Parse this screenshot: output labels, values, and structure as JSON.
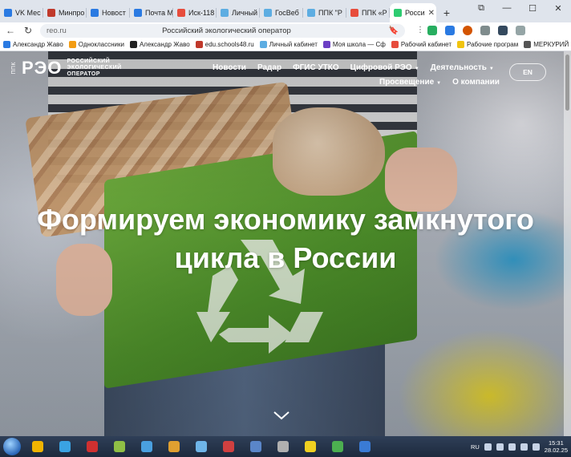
{
  "browser": {
    "tabs": [
      {
        "label": "VK Мес",
        "color": "#2a7ae2"
      },
      {
        "label": "Минпро",
        "color": "#c0392b"
      },
      {
        "label": "Новост",
        "color": "#2a7ae2"
      },
      {
        "label": "Почта М",
        "color": "#2a7ae2"
      },
      {
        "label": "Иск-118",
        "color": "#e74c3c"
      },
      {
        "label": "Личный",
        "color": "#5dade2"
      },
      {
        "label": "ГосВеб",
        "color": "#5dade2"
      },
      {
        "label": "ППК \"Р",
        "color": "#5dade2"
      },
      {
        "label": "ППК «Р",
        "color": "#e74c3c"
      },
      {
        "label": "Росси",
        "color": "#2ecc71",
        "active": true
      }
    ],
    "address_host": "reo.ru",
    "address_title": "Российский экологический оператор",
    "window_controls": [
      "⧉",
      "—",
      "☐",
      "✕"
    ]
  },
  "bookmarks": [
    {
      "label": "Александр Жаво",
      "color": "#2a7ae2"
    },
    {
      "label": "Одноклассники",
      "color": "#f39c12"
    },
    {
      "label": "Александр Жаво",
      "color": "#222222"
    },
    {
      "label": "edu.schools48.ru",
      "color": "#c0392b"
    },
    {
      "label": "Личный кабинет",
      "color": "#5dade2"
    },
    {
      "label": "Моя школа — Сф",
      "color": "#6c3fc4"
    },
    {
      "label": "Рабочий кабинет",
      "color": "#e74c3c"
    },
    {
      "label": "Рабочие програм",
      "color": "#f1c40f"
    },
    {
      "label": "МЕРКУРИЙ (",
      "color": "#555555"
    }
  ],
  "site": {
    "logo_ppk": "ППК",
    "logo_mark": "РЭО",
    "logo_sub": [
      "РОССИЙСКИЙ",
      "ЭКОЛОГИЧЕСКИЙ",
      "ОПЕРАТОР"
    ],
    "nav_row1": [
      {
        "label": "Новости",
        "dropdown": false
      },
      {
        "label": "Радар",
        "dropdown": false
      },
      {
        "label": "ФГИС УТКО",
        "dropdown": false
      },
      {
        "label": "Цифровой РЭО",
        "dropdown": true
      },
      {
        "label": "Деятельность",
        "dropdown": true
      }
    ],
    "nav_row2": [
      {
        "label": "Просвещение",
        "dropdown": true
      },
      {
        "label": "О компании",
        "dropdown": false
      }
    ],
    "lang_button": "EN",
    "hero_line1": "Формируем экономику замкнутого",
    "hero_line2": "цикла в России",
    "scroll_icon": "chevron-down-icon"
  },
  "taskbar": {
    "apps": [
      "#f0b400",
      "#3aa3e3",
      "#d03030",
      "#8fbf45",
      "#4aa0e0",
      "#e0a030",
      "#6fb5e8",
      "#d04040",
      "#5a86c8",
      "#b0b0b0",
      "#f0d020",
      "#4caf50",
      "#3a7bd5"
    ],
    "lang": "RU",
    "time": "15:31",
    "date": "28.02.25"
  }
}
